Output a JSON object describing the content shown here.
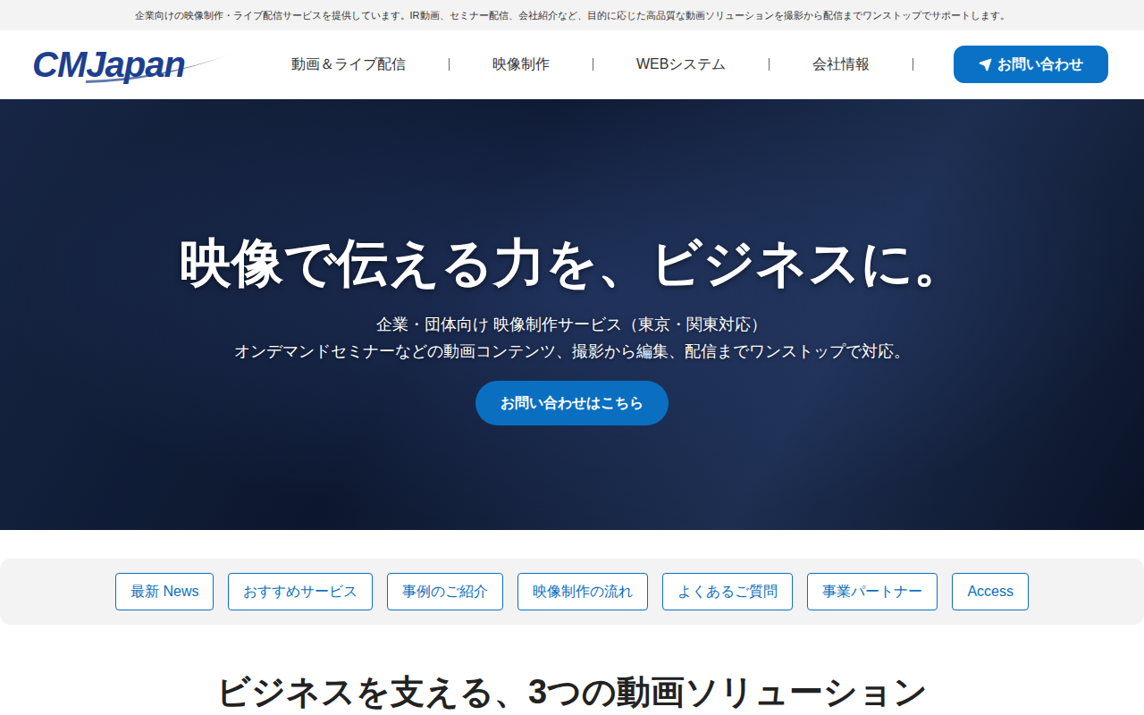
{
  "top_bar": {
    "text": "企業向けの映像制作・ライブ配信サービスを提供しています。IR動画、セミナー配信、会社紹介など、目的に応じた高品質な動画ソリューションを撮影から配信までワンストップでサポートします。"
  },
  "header": {
    "logo": "CMJapan",
    "nav": [
      "動画＆ライブ配信",
      "映像制作",
      "WEBシステム",
      "会社情報"
    ],
    "contact_button": "お問い合わせ"
  },
  "hero": {
    "title": "映像で伝える力を、ビジネスに。",
    "subtitle_lines": [
      "企業・団体向け 映像制作サービス（東京・関東対応）",
      "オンデマンドセミナーなどの動画コンテンツ、撮影から編集、配信までワンストップで対応。"
    ],
    "button": "お問い合わせはこちら"
  },
  "anchor_nav": [
    "最新 News",
    "おすすめサービス",
    "事例のご紹介",
    "映像制作の流れ",
    "よくあるご質問",
    "事業パートナー",
    "Access"
  ],
  "section": {
    "title": "ビジネスを支える、3つの動画ソリューション"
  }
}
